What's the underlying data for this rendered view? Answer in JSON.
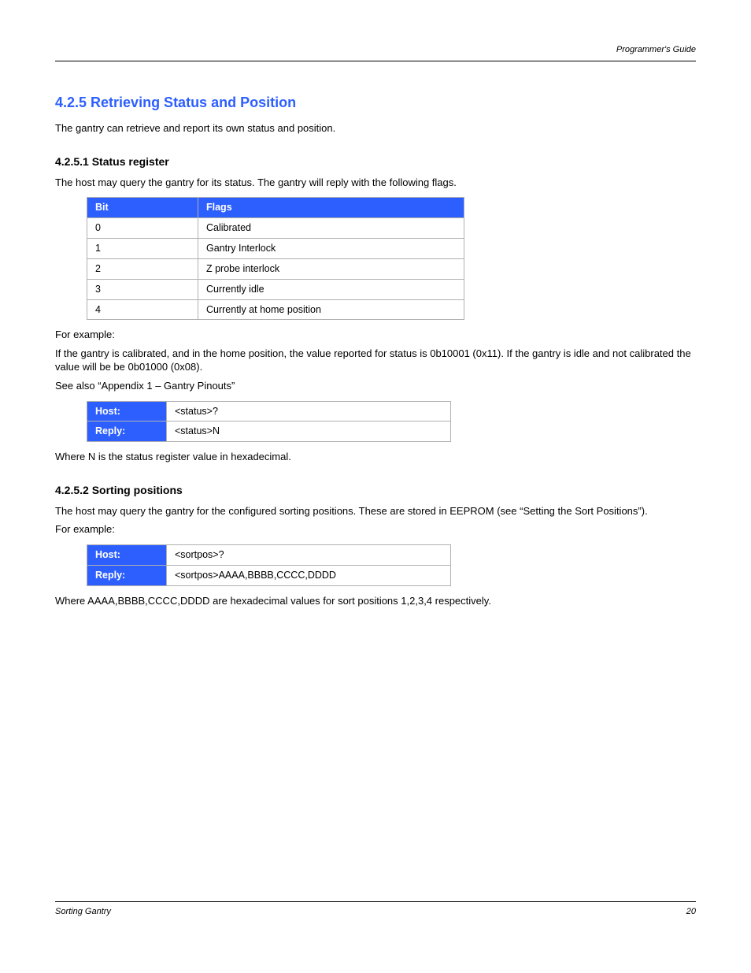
{
  "header": {
    "left": "",
    "right": "Programmer's Guide"
  },
  "section": {
    "heading": "4.2.5 Retrieving Status and Position",
    "intro": "The gantry can retrieve and report its own status and position.",
    "status_heading": "4.2.5.1 Status register",
    "status_intro": "The host may query the gantry for its status. The gantry will reply with the following flags."
  },
  "status_table": {
    "caption": "",
    "headers": [
      "Bit",
      "Flags"
    ],
    "rows": [
      [
        "0",
        "Calibrated"
      ],
      [
        "1",
        "Gantry Interlock"
      ],
      [
        "2",
        "Z probe interlock"
      ],
      [
        "3",
        "Currently idle"
      ],
      [
        "4",
        "Currently at home position"
      ]
    ]
  },
  "example1": {
    "intro_1": "For example:",
    "intro_2": "If the gantry is calibrated, and in the home position, the value reported for status is 0b10001 (0x11). If the gantry is idle and not calibrated the value will be be 0b01000 (0x08).",
    "see_also": "See also “Appendix 1 – Gantry Pinouts”",
    "command_table": {
      "rows": [
        [
          "Host:",
          "<status>?"
        ],
        [
          "Reply:",
          "<status>N"
        ]
      ]
    },
    "where": "Where N is the status register value in hexadecimal."
  },
  "sort_pos": {
    "heading": "4.2.5.2 Sorting positions",
    "intro": "The host may query the gantry for the configured sorting positions. These are stored in EEPROM (see “Setting the Sort Positions”).",
    "example": "For example:",
    "command_table": {
      "rows": [
        [
          "Host:",
          "<sortpos>?"
        ],
        [
          "Reply:",
          "<sortpos>AAAA,BBBB,CCCC,DDDD"
        ]
      ]
    },
    "where": "Where AAAA,BBBB,CCCC,DDDD are hexadecimal values for sort positions 1,2,3,4 respectively."
  },
  "footer": {
    "left": "Sorting Gantry",
    "right": "20"
  }
}
